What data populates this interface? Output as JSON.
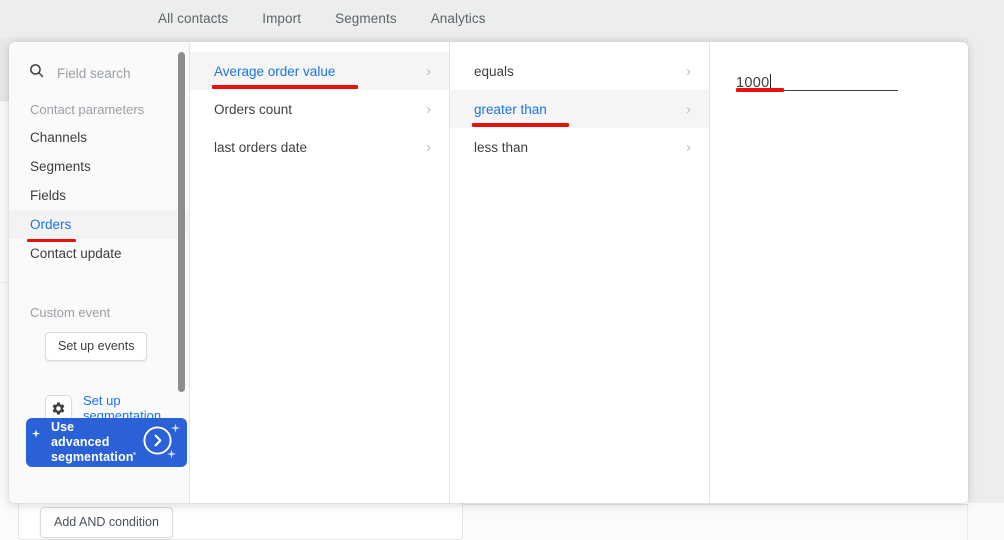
{
  "colors": {
    "accent_blue": "#1a73e8",
    "annotation_red": "#e8120c",
    "primary_button": "#2b61d7",
    "page_background": "#eceded",
    "panel_background": "#ffffff",
    "sidebar_background": "#fafafa"
  },
  "topnav": {
    "tabs": [
      {
        "label": "All contacts"
      },
      {
        "label": "Import"
      },
      {
        "label": "Segments"
      },
      {
        "label": "Analytics"
      }
    ]
  },
  "page": {
    "refresh_icon": "refresh-icon"
  },
  "sidebar": {
    "search": {
      "icon": "search-icon",
      "placeholder": "Field search",
      "value": ""
    },
    "group_label": "Contact parameters",
    "items": [
      {
        "label": "Channels",
        "selected": false
      },
      {
        "label": "Segments",
        "selected": false
      },
      {
        "label": "Fields",
        "selected": false
      },
      {
        "label": "Orders",
        "selected": true
      },
      {
        "label": "Contact update",
        "selected": false
      }
    ],
    "custom_event_label": "Custom event",
    "setup_events_label": "Set up events",
    "setup_segmentation": {
      "icon": "gear-icon",
      "label": "Set up segmentation"
    },
    "advanced_button": {
      "label": "Use advanced segmentation",
      "icon": "sparkle-icon",
      "arrow_icon": "chevron-right-circle-icon"
    }
  },
  "column_fields": {
    "items": [
      {
        "label": "Average order value",
        "selected": true
      },
      {
        "label": "Orders count",
        "selected": false
      },
      {
        "label": "last orders date",
        "selected": false
      }
    ],
    "chevron_icon": "chevron-right-icon"
  },
  "column_operators": {
    "items": [
      {
        "label": "equals",
        "selected": false
      },
      {
        "label": "greater than",
        "selected": true
      },
      {
        "label": "less than",
        "selected": false
      }
    ],
    "chevron_icon": "chevron-right-icon"
  },
  "column_value": {
    "value": "1000",
    "placeholder": ""
  },
  "footer": {
    "add_and_condition_label": "Add AND condition"
  }
}
